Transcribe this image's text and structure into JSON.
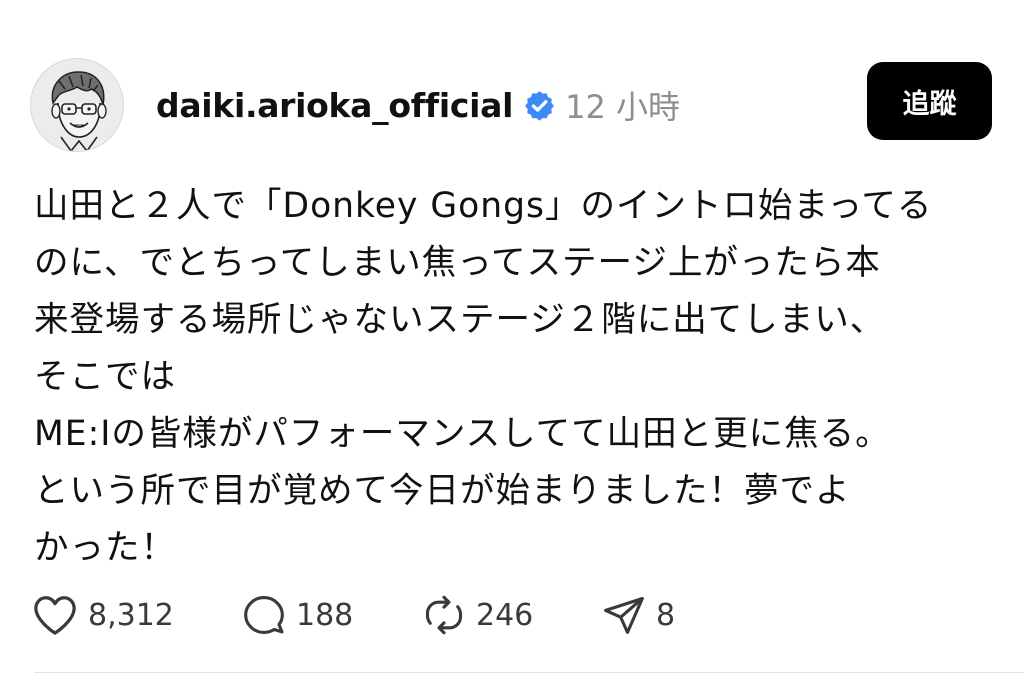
{
  "post": {
    "author": {
      "username": "daiki.arioka_official",
      "verified_icon": "verified-badge-icon",
      "avatar_icon": "avatar-illustration"
    },
    "timestamp": "12 小時",
    "follow_label": "追蹤",
    "text": {
      "paragraph_1": "山田と２人で「Donkey Gongs」のイントロ始まってる\nのに、でとちってしまい焦ってステージ上がったら本\n来登場する場所じゃないステージ２階に出てしまい、\nそこでは",
      "paragraph_2": "ME:Iの皆様がパフォーマンスしてて山田と更に焦る。\nという所で目が覚めて今日が始まりました！夢でよ\nかった！"
    },
    "actions": {
      "likes": "8,312",
      "replies": "188",
      "reposts": "246",
      "shares": "8"
    }
  },
  "colors": {
    "verified_blue": "#3d8af7",
    "timestamp_gray": "#8e8e8e",
    "follow_bg": "#000000"
  }
}
